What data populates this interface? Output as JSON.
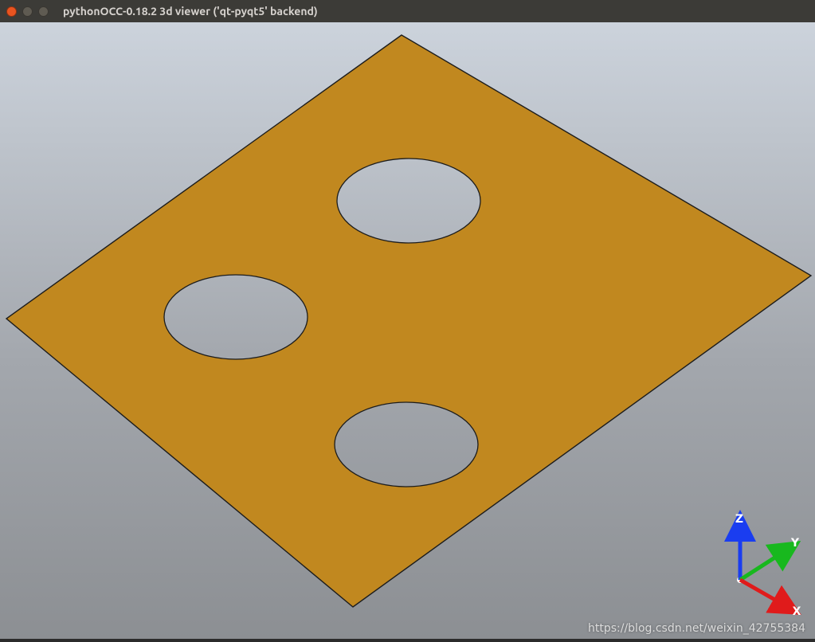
{
  "window": {
    "title": "pythonOCC-0.18.2 3d viewer ('qt-pyqt5' backend)",
    "buttons": {
      "close_color": "#e95420",
      "minimize_color": "#5f5b52",
      "maximize_color": "#5f5b52"
    }
  },
  "axes": {
    "z": "Z",
    "y": "Y",
    "x": "X"
  },
  "footer": {
    "watermark": "https://blog.csdn.net/weixin_42755384"
  }
}
